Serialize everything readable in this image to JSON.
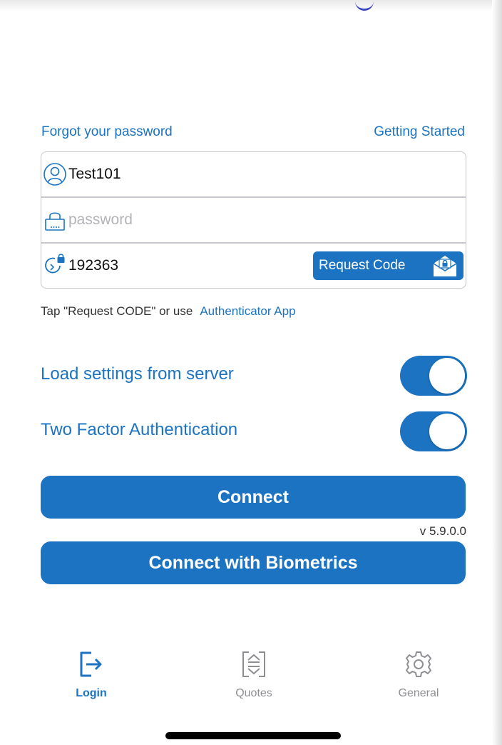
{
  "links": {
    "forgot_password": "Forgot your password",
    "getting_started": "Getting Started"
  },
  "form": {
    "username_value": "Test101",
    "password_value": "",
    "password_placeholder": "password",
    "code_value": "192363",
    "request_code_label": "Request Code"
  },
  "hint": {
    "text": "Tap \"Request CODE\" or use",
    "link": "Authenticator App"
  },
  "toggles": [
    {
      "label": "Load settings from server",
      "on": true
    },
    {
      "label": "Two Factor Authentication",
      "on": true
    }
  ],
  "buttons": {
    "connect": "Connect",
    "connect_biometrics": "Connect with Biometrics"
  },
  "version": "v 5.9.0.0",
  "tabs": [
    {
      "label": "Login",
      "icon": "login-icon",
      "active": true
    },
    {
      "label": "Quotes",
      "icon": "quotes-icon",
      "active": false
    },
    {
      "label": "General",
      "icon": "gear-icon",
      "active": false
    }
  ],
  "colors": {
    "accent": "#1b73c1",
    "inactive": "#8e8e93",
    "border": "#c7c7cc"
  }
}
